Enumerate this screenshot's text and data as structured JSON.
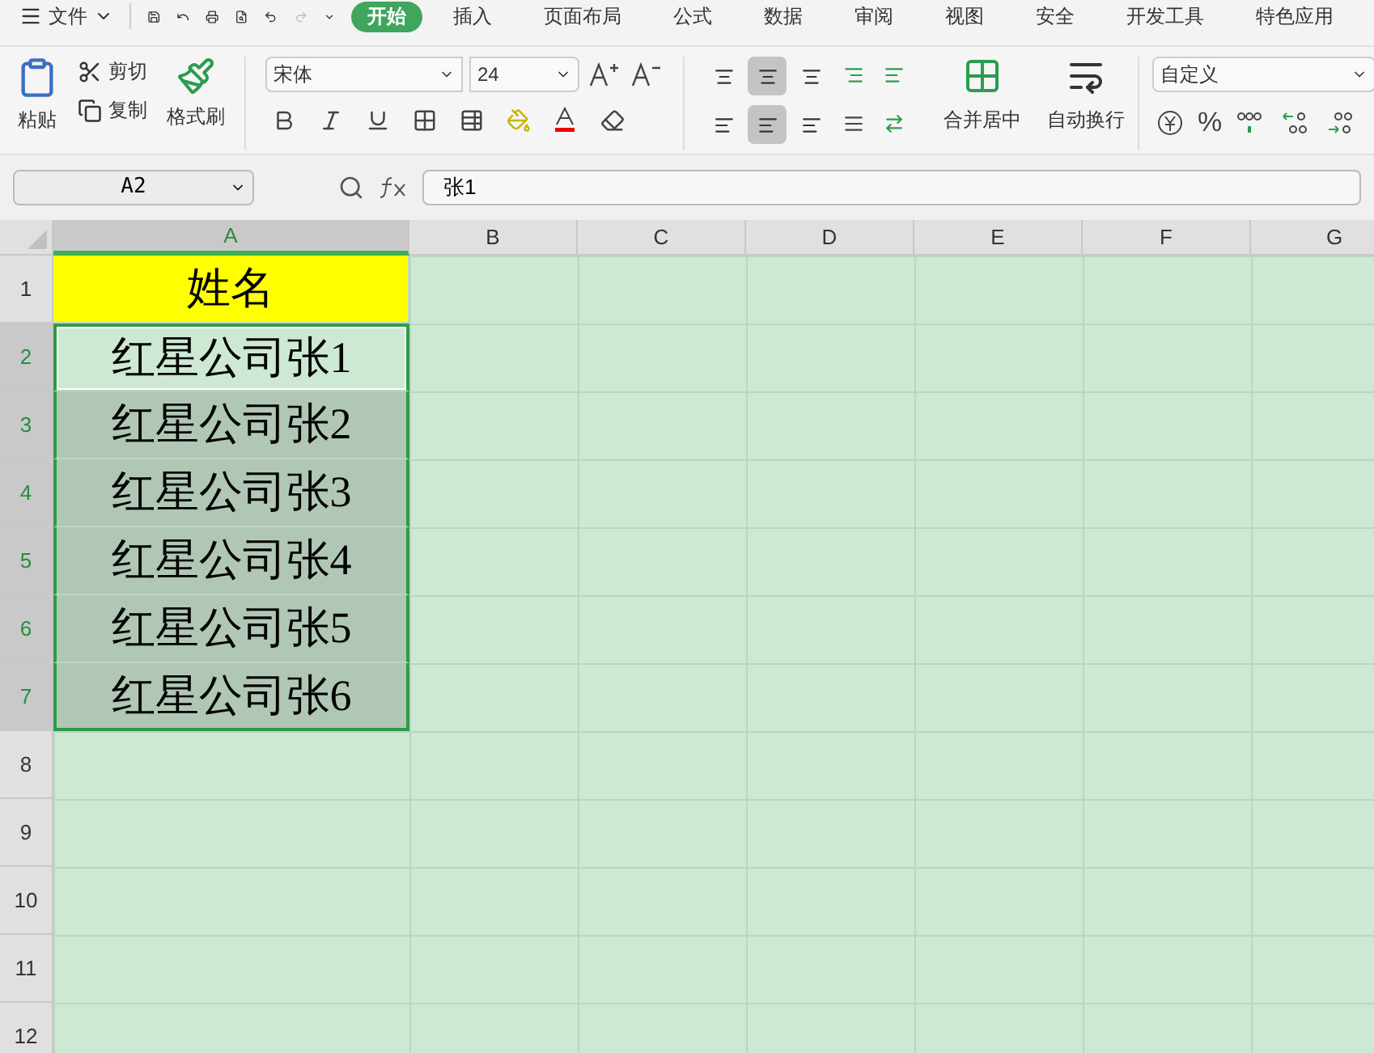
{
  "menu": {
    "label": "文件"
  },
  "tabs": [
    {
      "label": "开始",
      "selected": true
    },
    {
      "label": "插入",
      "selected": false
    },
    {
      "label": "页面布局",
      "selected": false
    },
    {
      "label": "公式",
      "selected": false
    },
    {
      "label": "数据",
      "selected": false
    },
    {
      "label": "审阅",
      "selected": false
    },
    {
      "label": "视图",
      "selected": false
    },
    {
      "label": "安全",
      "selected": false
    },
    {
      "label": "开发工具",
      "selected": false
    },
    {
      "label": "特色应用",
      "selected": false
    }
  ],
  "clipboard": {
    "paste": "粘贴",
    "cut": "剪切",
    "copy": "复制",
    "format_painter": "格式刷"
  },
  "font": {
    "name": "宋体",
    "size": "24"
  },
  "align_top_row": [
    {
      "selected": false
    },
    {
      "selected": true
    },
    {
      "selected": false
    }
  ],
  "align_bottom_row": [
    {
      "selected": false
    },
    {
      "selected": true
    },
    {
      "selected": false
    }
  ],
  "merge": "合并居中",
  "wrap": "自动换行",
  "number_format": "自定义",
  "percent": "%",
  "name_box": "A2",
  "formula": "张1",
  "columns": [
    {
      "label": "A",
      "selected": true
    },
    {
      "label": "B",
      "selected": false
    },
    {
      "label": "C",
      "selected": false
    },
    {
      "label": "D",
      "selected": false
    },
    {
      "label": "E",
      "selected": false
    },
    {
      "label": "F",
      "selected": false
    },
    {
      "label": "G",
      "selected": false
    }
  ],
  "rows": [
    {
      "label": "1",
      "selected": false,
      "cell": {
        "text": "姓名",
        "kind": "header",
        "selected": false,
        "active": false
      }
    },
    {
      "label": "2",
      "selected": true,
      "cell": {
        "text": "红星公司张1",
        "kind": "plain",
        "selected": true,
        "active": true
      }
    },
    {
      "label": "3",
      "selected": true,
      "cell": {
        "text": "红星公司张2",
        "kind": "plain",
        "selected": true,
        "active": false
      }
    },
    {
      "label": "4",
      "selected": true,
      "cell": {
        "text": "红星公司张3",
        "kind": "plain",
        "selected": true,
        "active": false
      }
    },
    {
      "label": "5",
      "selected": true,
      "cell": {
        "text": "红星公司张4",
        "kind": "plain",
        "selected": true,
        "active": false
      }
    },
    {
      "label": "6",
      "selected": true,
      "cell": {
        "text": "红星公司张5",
        "kind": "plain",
        "selected": true,
        "active": false
      }
    },
    {
      "label": "7",
      "selected": true,
      "cell": {
        "text": "红星公司张6",
        "kind": "plain",
        "selected": true,
        "active": false
      }
    },
    {
      "label": "8",
      "selected": false
    },
    {
      "label": "9",
      "selected": false
    },
    {
      "label": "10",
      "selected": false
    },
    {
      "label": "11",
      "selected": false
    },
    {
      "label": "12",
      "selected": false
    }
  ]
}
